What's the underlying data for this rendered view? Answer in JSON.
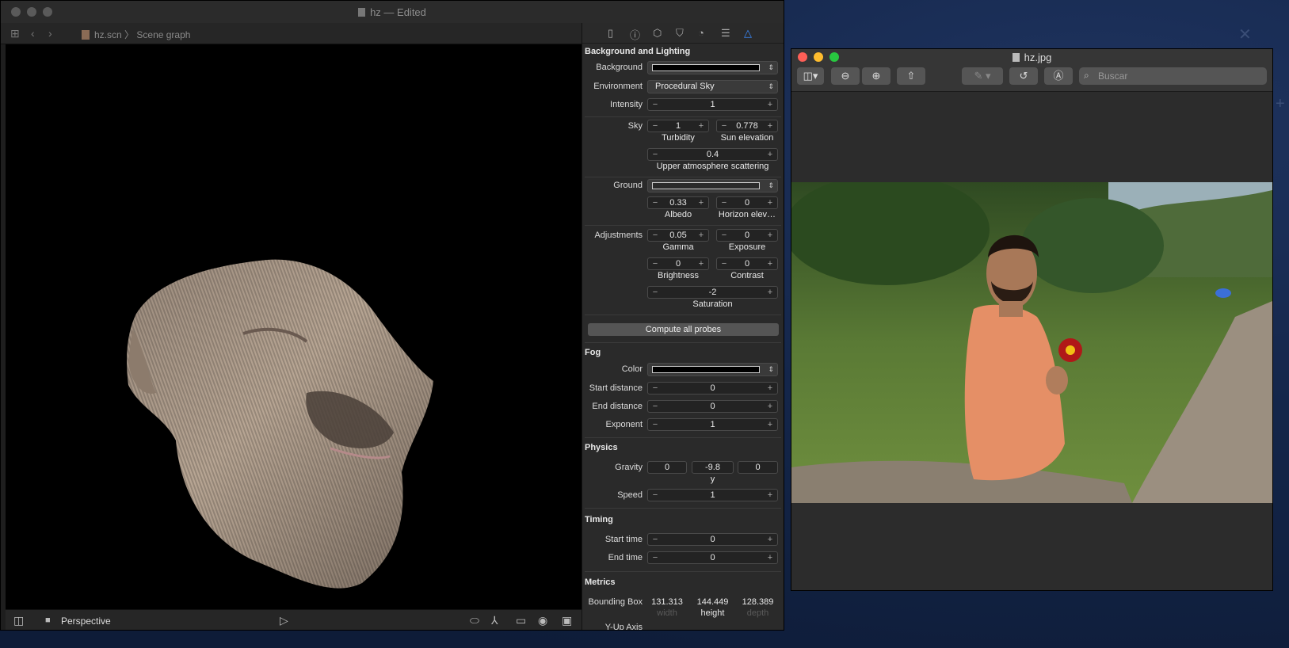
{
  "xcode": {
    "title": "hz — Edited",
    "breadcrumb": {
      "file": "hz.scn",
      "separator": "〉",
      "section": "Scene graph"
    },
    "viewport_toolbar": {
      "camera": "Perspective"
    },
    "inspector": {
      "sec_bg": "Background and Lighting",
      "background_label": "Background",
      "environment_label": "Environment",
      "environment_value": "Procedural Sky",
      "intensity_label": "Intensity",
      "intensity_value": "1",
      "sky_label": "Sky",
      "turbidity": "1",
      "turbidity_label": "Turbidity",
      "sun_elevation": "0.778",
      "sun_elevation_label": "Sun elevation",
      "upper_atmo": "0.4",
      "upper_atmo_label": "Upper atmosphere scattering",
      "ground_label": "Ground",
      "albedo": "0.33",
      "albedo_label": "Albedo",
      "horizon": "0",
      "horizon_label": "Horizon elev…",
      "adjustments_label": "Adjustments",
      "gamma": "0.05",
      "gamma_label": "Gamma",
      "exposure": "0",
      "exposure_label": "Exposure",
      "brightness": "0",
      "brightness_label": "Brightness",
      "contrast": "0",
      "contrast_label": "Contrast",
      "saturation": "-2",
      "saturation_label": "Saturation",
      "compute_btn": "Compute all probes",
      "sec_fog": "Fog",
      "fog_color_label": "Color",
      "fog_start_label": "Start distance",
      "fog_start": "0",
      "fog_end_label": "End distance",
      "fog_end": "0",
      "fog_exp_label": "Exponent",
      "fog_exp": "1",
      "sec_physics": "Physics",
      "gravity_label": "Gravity",
      "gravity_x": "0",
      "gravity_y": "-9.8",
      "gravity_z": "0",
      "gravity_y_label": "y",
      "speed_label": "Speed",
      "speed": "1",
      "sec_timing": "Timing",
      "start_time_label": "Start time",
      "start_time": "0",
      "end_time_label": "End time",
      "end_time": "0",
      "sec_metrics": "Metrics",
      "bbox_label": "Bounding Box",
      "bbox_w": "131.313",
      "bbox_h": "144.449",
      "bbox_d": "128.389",
      "bbox_w_label": "width",
      "bbox_h_label": "height",
      "bbox_d_label": "depth",
      "yup_label": "Y-Up Axis"
    }
  },
  "preview": {
    "title": "hz.jpg",
    "search_placeholder": "Buscar"
  },
  "colors": {
    "accent": "#3b8cff",
    "close": "#fe5f57",
    "minimize": "#febc2e",
    "zoom": "#28c840"
  }
}
